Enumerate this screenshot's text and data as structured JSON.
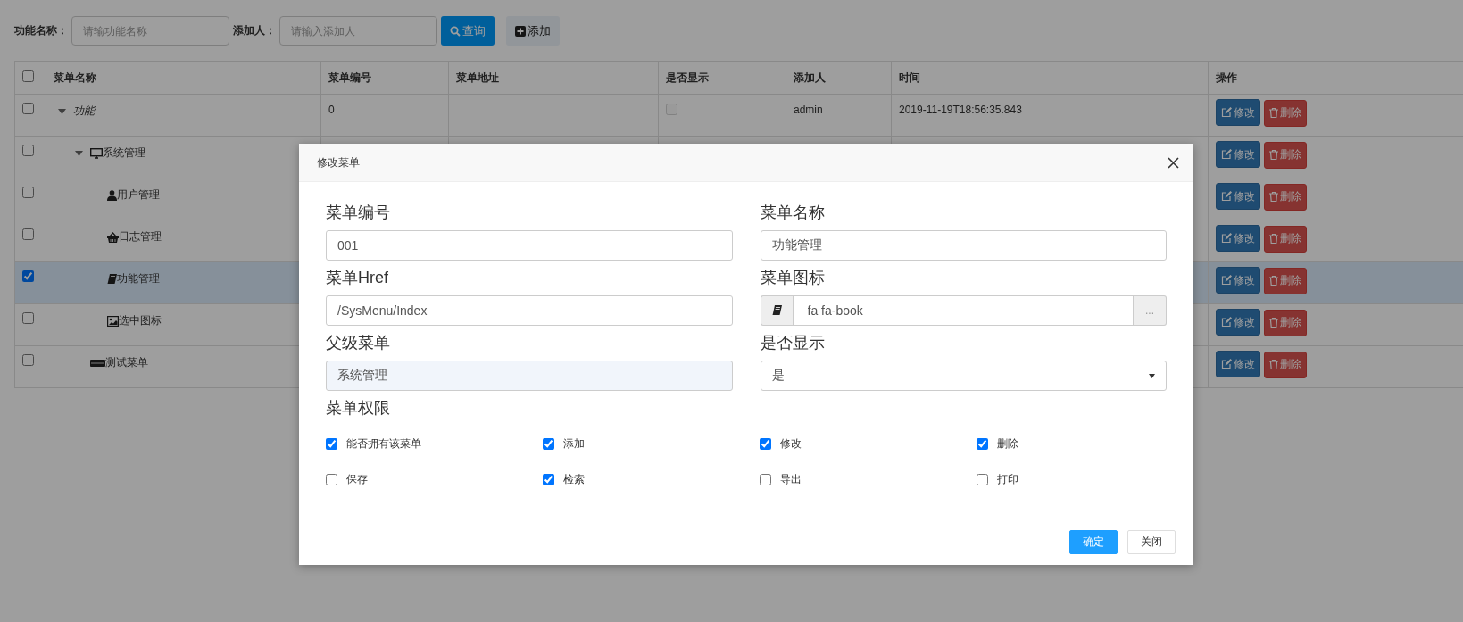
{
  "search": {
    "fields": [
      {
        "label": "功能名称：",
        "placeholder": "请输功能名称"
      },
      {
        "label": "添加人：",
        "placeholder": "请输入添加人"
      }
    ],
    "buttons": [
      {
        "label": "查询",
        "kind": "search"
      },
      {
        "label": "添加",
        "kind": "add"
      }
    ]
  },
  "table": {
    "header_checked": false,
    "columns": [
      "菜单名称",
      "菜单编号",
      "菜单地址",
      "是否显示",
      "添加人",
      "时间",
      "操作"
    ],
    "rows": [
      {
        "name": "功能",
        "checked": false,
        "expanded": true,
        "code": "0",
        "display_checked": false,
        "display_disabled": true,
        "added_by": "admin",
        "time": "2019-11-19T18:56:35.843",
        "actions": [
          {
            "label": "修改",
            "kind": "edit"
          },
          {
            "label": "删除",
            "kind": "delete"
          }
        ],
        "children": [
          {
            "name": "系统管理",
            "kind": "desktop",
            "checked": false,
            "expanded": true,
            "actions": [
              {
                "label": "修改",
                "kind": "edit"
              },
              {
                "label": "删除",
                "kind": "delete"
              }
            ],
            "children": [
              {
                "name": "用户管理",
                "kind": "user",
                "checked": false,
                "actions": [
                  {
                    "label": "修改",
                    "kind": "edit"
                  },
                  {
                    "label": "删除",
                    "kind": "delete"
                  }
                ]
              },
              {
                "name": "日志管理",
                "kind": "basket",
                "checked": false,
                "actions": [
                  {
                    "label": "修改",
                    "kind": "edit"
                  },
                  {
                    "label": "删除",
                    "kind": "delete"
                  }
                ]
              },
              {
                "name": "功能管理",
                "kind": "book",
                "checked": true,
                "actions": [
                  {
                    "label": "修改",
                    "kind": "edit"
                  },
                  {
                    "label": "删除",
                    "kind": "delete"
                  }
                ]
              },
              {
                "name": "选中图标",
                "kind": "image",
                "checked": false,
                "actions": [
                  {
                    "label": "修改",
                    "kind": "edit"
                  },
                  {
                    "label": "删除",
                    "kind": "delete"
                  }
                ]
              }
            ]
          },
          {
            "name": "测试菜单",
            "kind": "drive",
            "checked": false,
            "actions": [
              {
                "label": "修改",
                "kind": "edit"
              },
              {
                "label": "删除",
                "kind": "delete"
              }
            ]
          }
        ]
      }
    ]
  },
  "modal": {
    "title": "修改菜单",
    "fields": [
      {
        "label": "菜单编号",
        "kind": "text",
        "value": "001"
      },
      {
        "label": "菜单名称",
        "kind": "text",
        "value": "功能管理"
      },
      {
        "label": "菜单Href",
        "kind": "text",
        "value": "/SysMenu/Index"
      },
      {
        "label": "菜单图标",
        "kind": "icon",
        "value": "fa fa-book",
        "button": "..."
      },
      {
        "label": "父级菜单",
        "kind": "readonly",
        "value": "系统管理"
      },
      {
        "label": "是否显示",
        "kind": "select",
        "value": "是"
      }
    ],
    "permissions": {
      "label": "菜单权限",
      "items": [
        {
          "label": "能否拥有该菜单",
          "checked": true
        },
        {
          "label": "添加",
          "checked": true
        },
        {
          "label": "修改",
          "checked": true
        },
        {
          "label": "删除",
          "checked": true
        },
        {
          "label": "保存",
          "checked": false
        },
        {
          "label": "检索",
          "checked": true
        },
        {
          "label": "导出",
          "checked": false
        },
        {
          "label": "打印",
          "checked": false
        }
      ]
    },
    "buttons": [
      {
        "label": "确定",
        "kind": "primary"
      },
      {
        "label": "关闭",
        "kind": "default"
      }
    ]
  }
}
